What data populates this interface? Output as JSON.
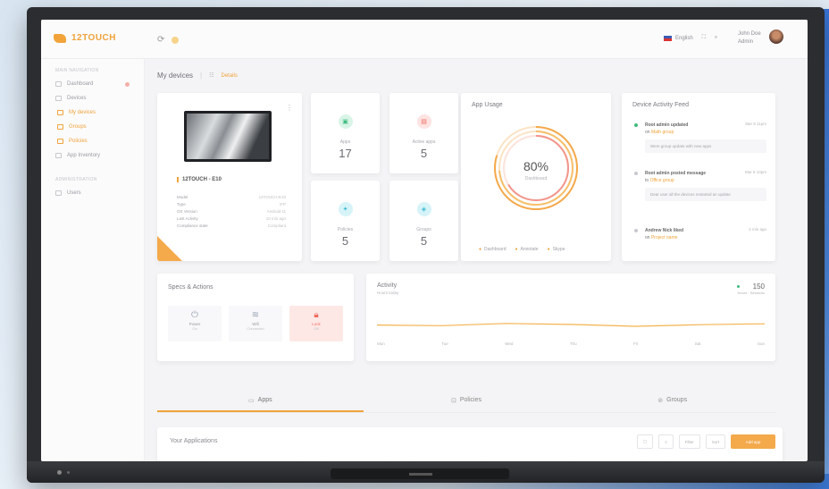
{
  "brand": {
    "name": "12TOUCH"
  },
  "topbar": {
    "language": "English",
    "user_name": "John Doe",
    "user_role": "Admin"
  },
  "sidebar": {
    "section1": "MAIN NAVIGATION",
    "items": [
      {
        "label": "Dashboard"
      },
      {
        "label": "Devices"
      },
      {
        "label": "My devices"
      },
      {
        "label": "Groups"
      },
      {
        "label": "Policies"
      },
      {
        "label": "App Inventory"
      }
    ],
    "section2": "ADMINISTRATION",
    "items2": [
      {
        "label": "Users"
      }
    ]
  },
  "page": {
    "title": "My devices",
    "crumb": "Details"
  },
  "device": {
    "name": "12TOUCH - E10",
    "specs": [
      {
        "k": "Model",
        "v": "12TOUCH-E10"
      },
      {
        "k": "Type",
        "v": "IFP"
      },
      {
        "k": "OS Version",
        "v": "Android 11"
      },
      {
        "k": "Last Activity",
        "v": "10 min ago"
      },
      {
        "k": "Compliance state",
        "v": "Compliant"
      }
    ]
  },
  "stats": [
    {
      "label": "Apps",
      "value": "17"
    },
    {
      "label": "Active apps",
      "value": "5"
    },
    {
      "label": "Policies",
      "value": "5"
    },
    {
      "label": "Groups",
      "value": "5"
    }
  ],
  "usage": {
    "title": "App Usage",
    "percent": "80%",
    "sub": "Dashboard",
    "legend": [
      "Dashboard",
      "Annotate",
      "Skype"
    ]
  },
  "feed": {
    "title": "Device Activity Feed",
    "items": [
      {
        "title": "Root admin updated",
        "pre": "on",
        "link": "Math group",
        "time": "Mar 8 11pm",
        "note": "Were group update with new apps"
      },
      {
        "title": "Root admin posted message",
        "pre": "to",
        "link": "Office group",
        "time": "Mar 8 10pm",
        "note": "Dear user all the devices restarted an update"
      },
      {
        "title": "Andrew Nick liked",
        "pre": "on",
        "link": "Project name",
        "time": "2 min ago",
        "note": ""
      }
    ]
  },
  "specs_actions": {
    "title": "Specs & Actions",
    "actions": [
      {
        "label": "Power",
        "sub": "On"
      },
      {
        "label": "Wifi",
        "sub": "Connected"
      },
      {
        "label": "Lock",
        "sub": "Off"
      }
    ]
  },
  "activity": {
    "title": "Activity",
    "sub": "Hours today",
    "stat_value": "150",
    "stat_label": "Hours · Sessions",
    "days": [
      "Mon",
      "Tue",
      "Wed",
      "Thu",
      "Fri",
      "Sat",
      "Sun"
    ]
  },
  "chart_data": {
    "type": "line",
    "x": [
      "Mon",
      "Tue",
      "Wed",
      "Thu",
      "Fri",
      "Sat",
      "Sun"
    ],
    "series": [
      {
        "values": [
          40,
          38,
          45,
          42,
          36,
          41,
          44
        ]
      }
    ],
    "ylim": [
      0,
      100
    ]
  },
  "tabs": [
    {
      "label": "Apps"
    },
    {
      "label": "Policies"
    },
    {
      "label": "Groups"
    }
  ],
  "apps": {
    "title": "Your Applications",
    "tools": [
      "",
      "",
      "Filter",
      "Sort"
    ],
    "primary": "Add app"
  }
}
